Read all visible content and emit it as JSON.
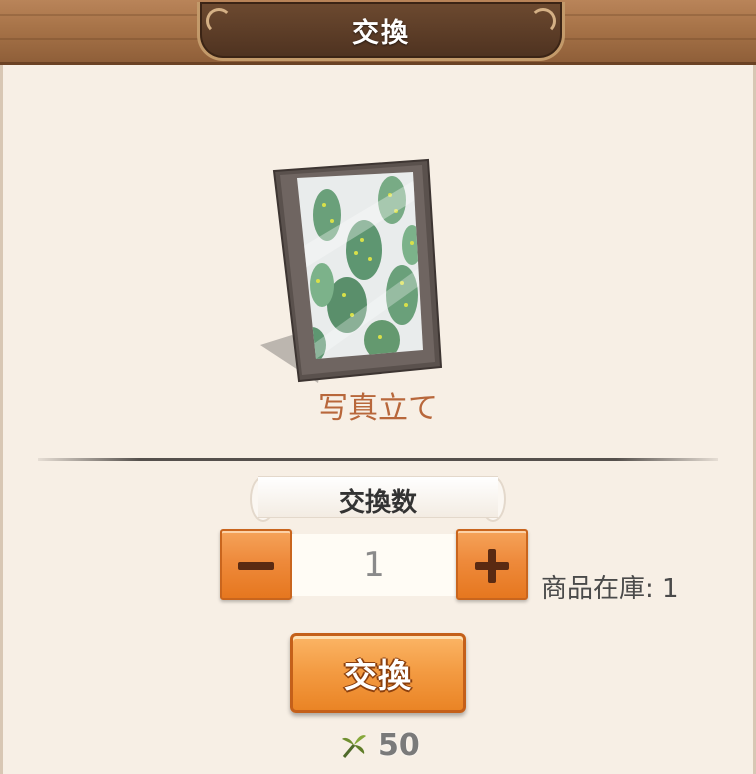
{
  "header": {
    "title": "交換"
  },
  "item": {
    "name": "写真立て",
    "image_icon": "cactus-photo-frame"
  },
  "quantity": {
    "label": "交換数",
    "value": "1",
    "minus_icon": "minus-icon",
    "plus_icon": "plus-icon"
  },
  "stock": {
    "text": "商品在庫: 1"
  },
  "exchange_button": {
    "label": "交換"
  },
  "cost": {
    "icon": "leaf-currency-icon",
    "amount": "50"
  },
  "colors": {
    "accent_orange": "#ee8a3b",
    "wood": "#a77348",
    "item_name": "#b8673b",
    "background": "#f7efe5"
  }
}
